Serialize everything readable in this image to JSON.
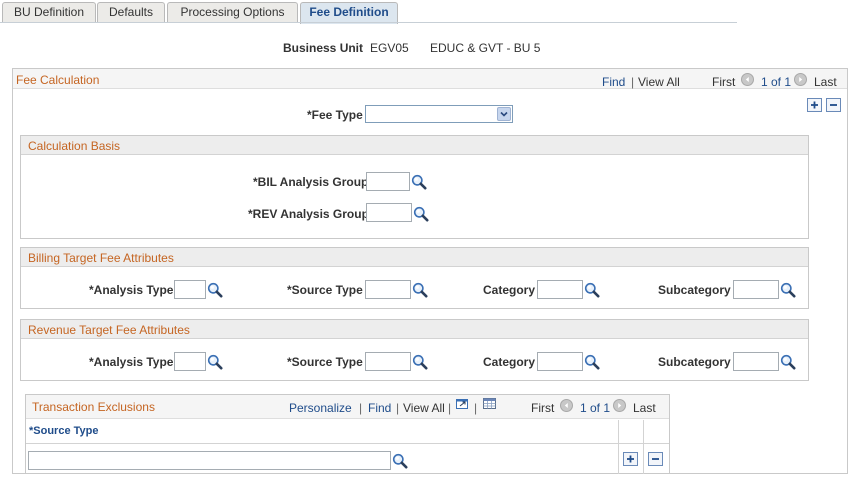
{
  "tabs": [
    {
      "label": "BU Definition",
      "active": false
    },
    {
      "label": "Defaults",
      "active": false
    },
    {
      "label": "Processing Options",
      "active": false
    },
    {
      "label": "Fee Definition",
      "active": true
    }
  ],
  "header": {
    "business_unit_label": "Business Unit",
    "business_unit_value": "EGV05",
    "business_unit_desc": "EDUC & GVT - BU 5"
  },
  "fee_calc": {
    "title": "Fee Calculation",
    "find": "Find",
    "view_all": "View All",
    "first": "First",
    "range": "1 of 1",
    "last": "Last",
    "fee_type_label": "*Fee Type",
    "fee_type_value": ""
  },
  "calc_basis": {
    "title": "Calculation Basis",
    "bil_label": "*BIL Analysis Group",
    "rev_label": "*REV Analysis Group"
  },
  "billing": {
    "title": "Billing Target Fee Attributes",
    "analysis_type": "*Analysis Type",
    "source_type": "*Source Type",
    "category": "Category",
    "subcategory": "Subcategory"
  },
  "revenue": {
    "title": "Revenue Target Fee Attributes",
    "analysis_type": "*Analysis Type",
    "source_type": "*Source Type",
    "category": "Category",
    "subcategory": "Subcategory"
  },
  "exclusions": {
    "title": "Transaction Exclusions",
    "personalize": "Personalize",
    "find": "Find",
    "view_all": "View All",
    "first": "First",
    "range": "1 of 1",
    "last": "Last",
    "col_source_type": "*Source Type"
  },
  "icons": {
    "lookup": "magnifier-icon",
    "add": "plus-icon",
    "delete": "minus-icon",
    "prev": "arrow-left-icon",
    "next": "arrow-right-icon",
    "zoom": "new-window-icon",
    "download": "spreadsheet-icon"
  },
  "colors": {
    "section_title": "#c56522",
    "link": "#1f4c8a",
    "active_tab": "#dce6ef"
  }
}
